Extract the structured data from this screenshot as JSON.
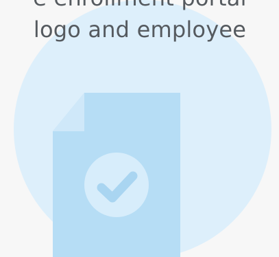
{
  "promo": {
    "line1": "e enrollment portal",
    "line2": "logo and employee"
  },
  "icons": {
    "document": "document-icon",
    "check": "check-icon"
  },
  "colors": {
    "background": "#f7f7f7",
    "circle": "#ddeffb",
    "document": "#b6ddf5",
    "fold": "#cfe8f9",
    "check_circle": "#d7edfb",
    "check_mark": "#a9d5f1",
    "text": "#555a5f"
  }
}
